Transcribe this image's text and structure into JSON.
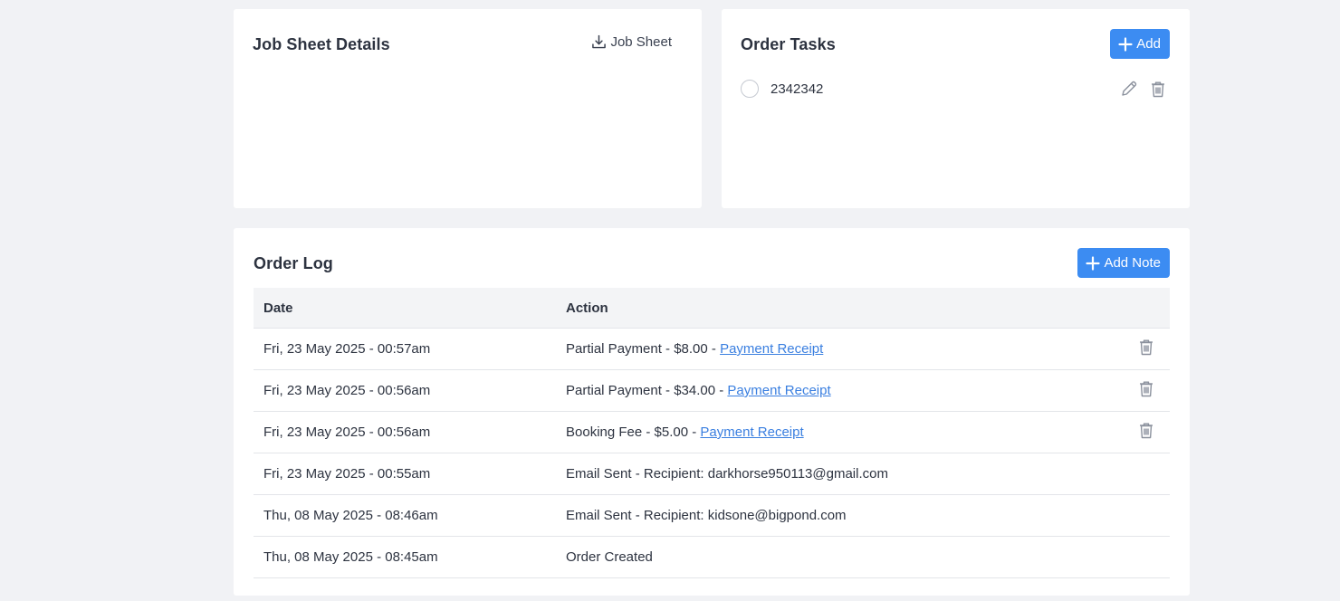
{
  "job_sheet": {
    "title": "Job Sheet Details",
    "download_label": "Job Sheet"
  },
  "order_tasks": {
    "title": "Order Tasks",
    "add_label": "Add",
    "items": [
      {
        "text": "2342342",
        "done": false
      }
    ]
  },
  "order_log": {
    "title": "Order Log",
    "add_note_label": "Add Note",
    "columns": [
      "Date",
      "Action"
    ],
    "rows": [
      {
        "date": "Fri, 23 May 2025 - 00:57am",
        "action": "Partial Payment - $8.00 - ",
        "link": "Payment Receipt",
        "deletable": true
      },
      {
        "date": "Fri, 23 May 2025 - 00:56am",
        "action": "Partial Payment - $34.00 - ",
        "link": "Payment Receipt",
        "deletable": true
      },
      {
        "date": "Fri, 23 May 2025 - 00:56am",
        "action": "Booking Fee - $5.00 - ",
        "link": "Payment Receipt",
        "deletable": true
      },
      {
        "date": "Fri, 23 May 2025 - 00:55am",
        "action": "Email Sent - Recipient: darkhorse950113@gmail.com",
        "link": "",
        "deletable": false
      },
      {
        "date": "Thu, 08 May 2025 - 08:46am",
        "action": "Email Sent - Recipient: kidsone@bigpond.com",
        "link": "",
        "deletable": false
      },
      {
        "date": "Thu, 08 May 2025 - 08:45am",
        "action": "Order Created",
        "link": "",
        "deletable": false
      }
    ]
  },
  "colors": {
    "accent": "#3c8cf2",
    "link": "#3a7fe0",
    "background": "#f1f2f5",
    "icon": "#8a909c"
  },
  "icons": {
    "download": "download-icon",
    "plus": "plus-icon",
    "edit": "pencil-icon",
    "delete": "trash-icon"
  }
}
